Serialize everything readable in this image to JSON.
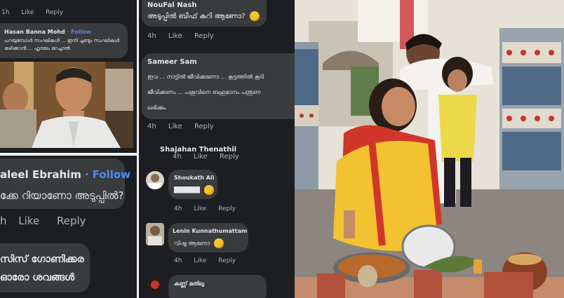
{
  "post_photo": {
    "colors": {
      "sari": "#f2c230",
      "border": "#d0362a",
      "floor": "#8d8580"
    }
  },
  "top_left": {
    "meta_top": {
      "time": "1h",
      "like": "Like",
      "reply": "Reply"
    },
    "comment": {
      "name": "Hasan Banna Mohd",
      "follow": "· Follow",
      "text": "പറയുമ്പോൾ സംഘികൾ ... ഇനി ചൂണ്ടും സംഘികൾ കഴിക്കാൻ ... ഹൃദയം മറച്ചാൽ"
    }
  },
  "top_mid": {
    "comment1": {
      "name": "NouFal Nash",
      "text": "അടുപ്പിൽ ബീഫ് കറി ആണോ?",
      "meta": {
        "time": "4h",
        "like": "Like",
        "reply": "Reply"
      }
    },
    "comment2": {
      "name": "Sameer Sam",
      "line1": "ഇവ ... നാട്ടിൽ ജീവിക്കണോ ... കൂട്ടത്തിൽ കൂടി",
      "line2": "ജീവിക്കണം ... പശുവിനെ ബഹുമാനം പന്തുണ",
      "line3": "ലഭിക്കും",
      "meta": {
        "time": "4h",
        "like": "Like",
        "reply": "Reply"
      }
    },
    "cutoff_name": "Shajahan Thenathil"
  },
  "bottom_left": {
    "name": "aleel Ebrahim",
    "follow": "· Follow",
    "text": "ക്കേ റിയാണോ അടുപ്പിൽ?",
    "meta": {
      "time": "h",
      "like": "Like",
      "reply": "Reply"
    },
    "text2_line1": "സിസ് ഗോണിക്കര",
    "text2_line2": "ഓരോ ശവങ്ങൾ"
  },
  "bottom_mid": {
    "meta_top": {
      "time": "4h",
      "like": "Like",
      "reply": "Reply"
    },
    "c1": {
      "name": "Shoukath Ali",
      "text": "██████",
      "meta": {
        "time": "4h",
        "like": "Like",
        "reply": "Reply"
      }
    },
    "c2": {
      "name": "Lenin Kunnathumattam",
      "text": "വിഷു ആണോ",
      "meta": {
        "time": "4h",
        "like": "Like",
        "reply": "Reply"
      }
    },
    "c3": {
      "name": "കണ്ണ് മതിലു"
    }
  }
}
